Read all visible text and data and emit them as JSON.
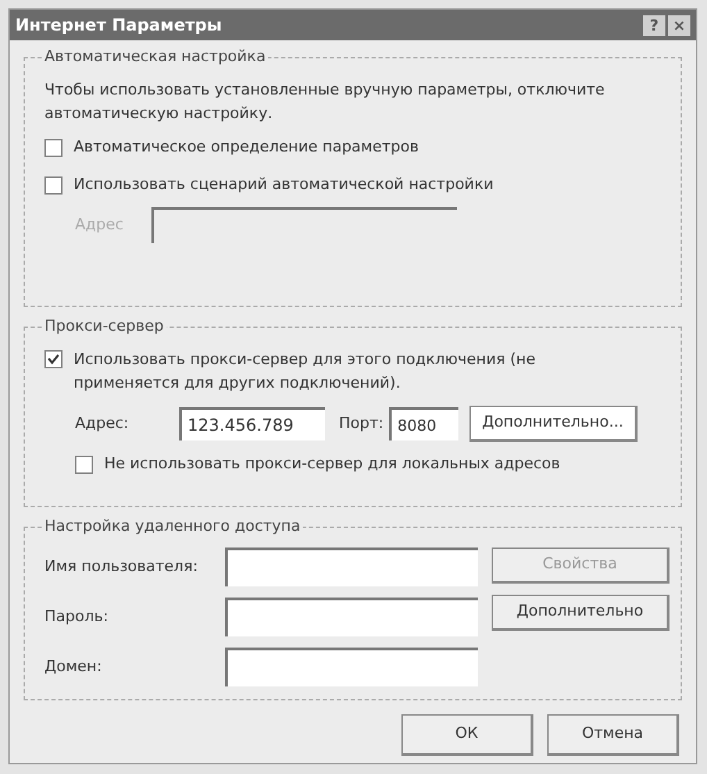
{
  "window": {
    "title": "Интернет Параметры",
    "title_buttons": [
      "?",
      "×"
    ]
  },
  "auto_config": {
    "title": "Автоматическая настройка",
    "description": "Чтобы использовать установленные вручную параметры, отключите автоматическую настройку.",
    "checkboxes": [
      {
        "label": "Автоматическое определение параметров",
        "checked": false
      },
      {
        "label": "Использовать сценарий автоматической настройки",
        "checked": false
      }
    ],
    "address": {
      "label": "Адрес",
      "disabled": true
    }
  },
  "proxy": {
    "title": "Прокси-сервер",
    "use_proxy": {
      "label": "Использовать прокси-сервер для этого подключения (не применяется для других подключений).",
      "checked": true
    },
    "address": {
      "label": "Адрес:",
      "value": "123.456.789"
    },
    "port": {
      "label": "Порт:",
      "value": "8080"
    },
    "advanced_button": "Дополнительно...",
    "bypass_local": {
      "label": "Не использовать прокси-сервер для локальных адресов",
      "checked": false
    }
  },
  "dialup": {
    "title": "Настройка удаленного доступа",
    "fields": [
      {
        "label": "Имя пользователя:"
      },
      {
        "label": "Пароль:"
      },
      {
        "label": "Домен:"
      }
    ],
    "buttons": [
      {
        "label": "Свойства",
        "disabled": true
      },
      {
        "label": "Дополнительно",
        "disabled": false
      }
    ]
  },
  "buttons": [
    "ОК",
    "Отмена"
  ]
}
